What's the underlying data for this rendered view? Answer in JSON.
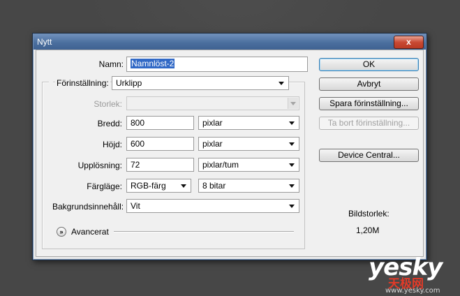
{
  "window": {
    "title": "Nytt",
    "close_glyph": "x"
  },
  "form": {
    "name_label": "Namn:",
    "name_value": "Namnlöst-2",
    "preset_label": "Förinställning:",
    "preset_value": "Urklipp",
    "size_label": "Storlek:",
    "size_value": "",
    "width_label": "Bredd:",
    "width_value": "800",
    "width_unit": "pixlar",
    "height_label": "Höjd:",
    "height_value": "600",
    "height_unit": "pixlar",
    "resolution_label": "Upplösning:",
    "resolution_value": "72",
    "resolution_unit": "pixlar/tum",
    "color_mode_label": "Färgläge:",
    "color_mode_value": "RGB-färg",
    "bit_depth_value": "8 bitar",
    "background_label": "Bakgrundsinnehåll:",
    "background_value": "Vit",
    "advanced_label": "Avancerat",
    "advanced_icon": "chevron-double-down-icon"
  },
  "buttons": {
    "ok": "OK",
    "cancel": "Avbryt",
    "save_preset": "Spara förinställning...",
    "delete_preset": "Ta bort förinställning...",
    "device_central": "Device Central..."
  },
  "info": {
    "image_size_label": "Bildstorlek:",
    "image_size_value": "1,20M"
  },
  "watermark": {
    "brand": "yesky",
    "chinese": "天极网",
    "domain": "www.yesky.com"
  }
}
